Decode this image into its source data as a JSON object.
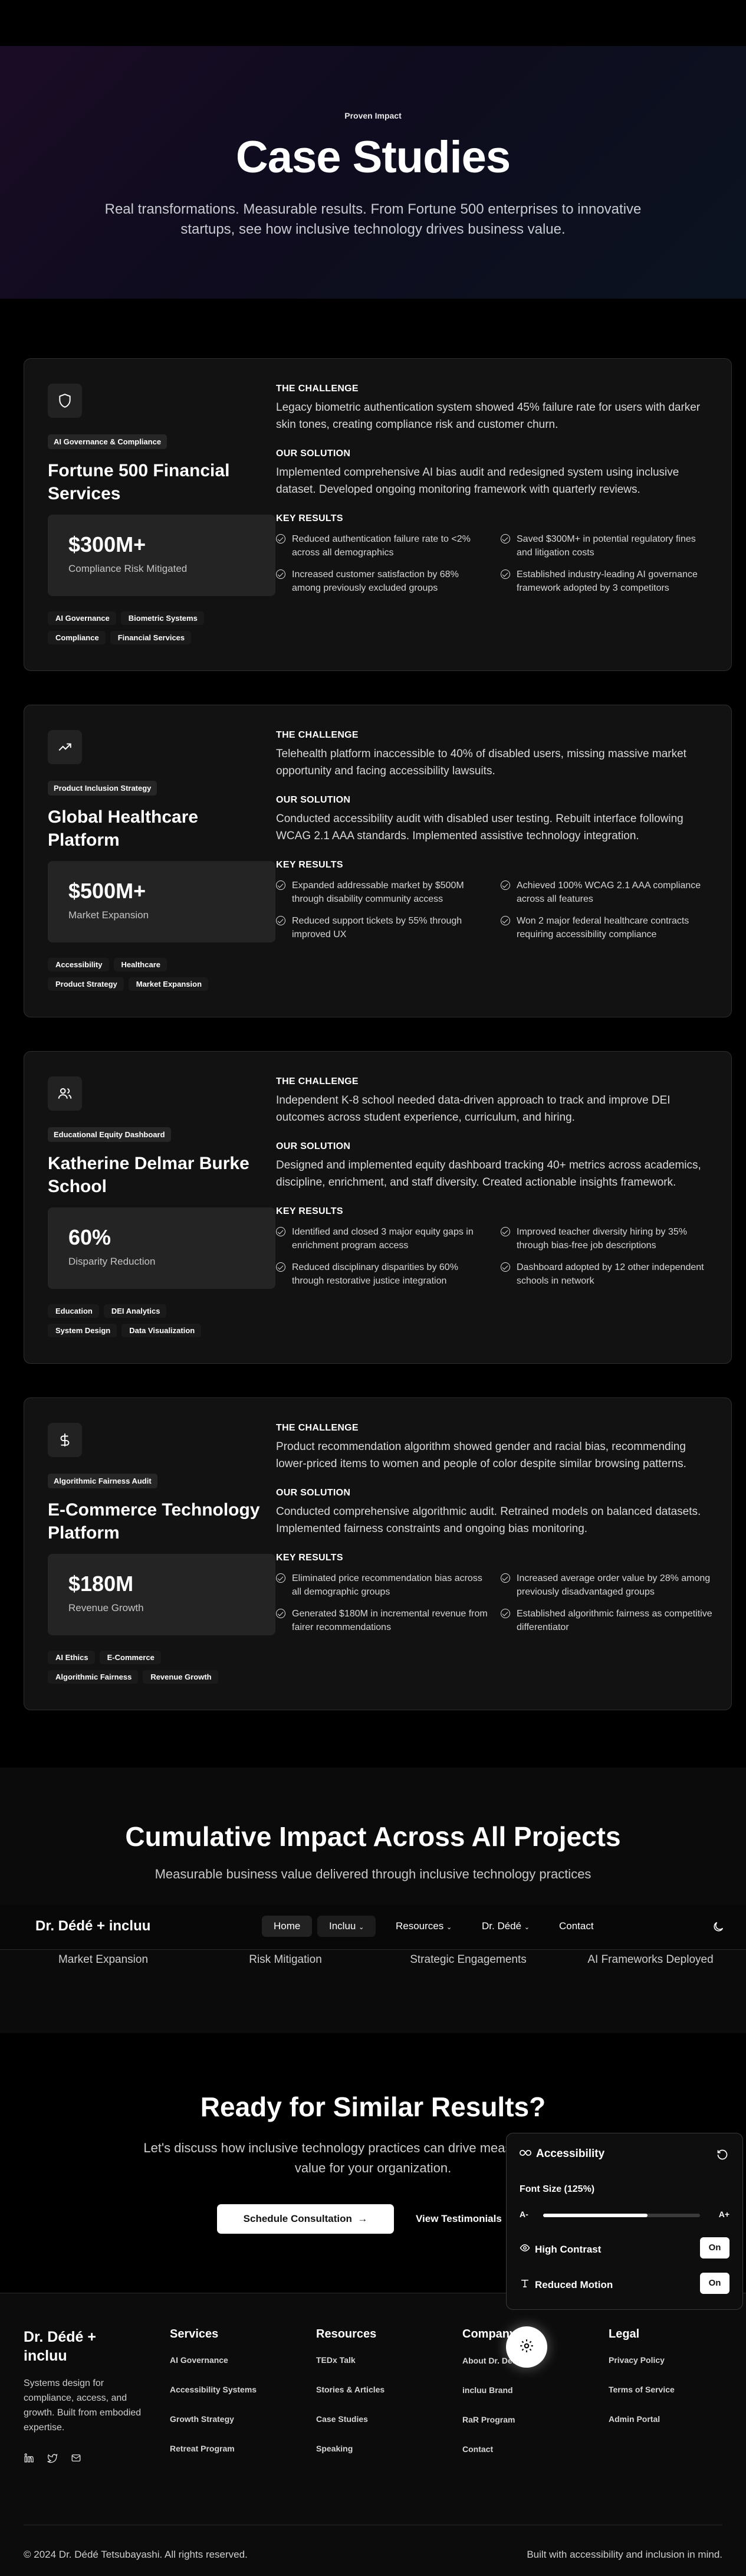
{
  "hero": {
    "kicker": "Proven Impact",
    "title": "Case Studies",
    "subtitle": "Real transformations. Measurable results. From Fortune 500 enterprises to innovative startups, see how inclusive technology drives business value."
  },
  "labels": {
    "challenge": "THE CHALLENGE",
    "solution": "OUR SOLUTION",
    "results": "KEY RESULTS"
  },
  "cases": [
    {
      "icon": "shield-icon",
      "category": "AI Governance & Compliance",
      "title": "Fortune 500 Financial Services",
      "metric_value": "$300M+",
      "metric_label": "Compliance Risk Mitigated",
      "tags": [
        "AI Governance",
        "Biometric Systems",
        "Compliance",
        "Financial Services"
      ],
      "challenge": "Legacy biometric authentication system showed 45% failure rate for users with darker skin tones, creating compliance risk and customer churn.",
      "solution": "Implemented comprehensive AI bias audit and redesigned system using inclusive dataset. Developed ongoing monitoring framework with quarterly reviews.",
      "results": [
        "Reduced authentication failure rate to <2% across all demographics",
        "Saved $300M+ in potential regulatory fines and litigation costs",
        "Increased customer satisfaction by 68% among previously excluded groups",
        "Established industry-leading AI governance framework adopted by 3 competitors"
      ]
    },
    {
      "icon": "trending-up-icon",
      "category": "Product Inclusion Strategy",
      "title": "Global Healthcare Platform",
      "metric_value": "$500M+",
      "metric_label": "Market Expansion",
      "tags": [
        "Accessibility",
        "Healthcare",
        "Product Strategy",
        "Market Expansion"
      ],
      "challenge": "Telehealth platform inaccessible to 40% of disabled users, missing massive market opportunity and facing accessibility lawsuits.",
      "solution": "Conducted accessibility audit with disabled user testing. Rebuilt interface following WCAG 2.1 AAA standards. Implemented assistive technology integration.",
      "results": [
        "Expanded addressable market by $500M through disability community access",
        "Achieved 100% WCAG 2.1 AAA compliance across all features",
        "Reduced support tickets by 55% through improved UX",
        "Won 2 major federal healthcare contracts requiring accessibility compliance"
      ]
    },
    {
      "icon": "users-icon",
      "category": "Educational Equity Dashboard",
      "title": "Katherine Delmar Burke School",
      "metric_value": "60%",
      "metric_label": "Disparity Reduction",
      "tags": [
        "Education",
        "DEI Analytics",
        "System Design",
        "Data Visualization"
      ],
      "challenge": "Independent K-8 school needed data-driven approach to track and improve DEI outcomes across student experience, curriculum, and hiring.",
      "solution": "Designed and implemented equity dashboard tracking 40+ metrics across academics, discipline, enrichment, and staff diversity. Created actionable insights framework.",
      "results": [
        "Identified and closed 3 major equity gaps in enrichment program access",
        "Improved teacher diversity hiring by 35% through bias-free job descriptions",
        "Reduced disciplinary disparities by 60% through restorative justice integration",
        "Dashboard adopted by 12 other independent schools in network"
      ]
    },
    {
      "icon": "dollar-icon",
      "category": "Algorithmic Fairness Audit",
      "title": "E-Commerce Technology Platform",
      "metric_value": "$180M",
      "metric_label": "Revenue Growth",
      "tags": [
        "AI Ethics",
        "E-Commerce",
        "Algorithmic Fairness",
        "Revenue Growth"
      ],
      "challenge": "Product recommendation algorithm showed gender and racial bias, recommending lower-priced items to women and people of color despite similar browsing patterns.",
      "solution": "Conducted comprehensive algorithmic audit. Retrained models on balanced datasets. Implemented fairness constraints and ongoing bias monitoring.",
      "results": [
        "Eliminated price recommendation bias across all demographic groups",
        "Increased average order value by 28% among previously disadvantaged groups",
        "Generated $180M in incremental revenue from fairer recommendations",
        "Established algorithmic fairness as competitive differentiator"
      ]
    }
  ],
  "impact": {
    "title": "Cumulative Impact Across All Projects",
    "subtitle": "Measurable business value delivered through inclusive technology practices",
    "stats": [
      "Market Expansion",
      "Risk Mitigation",
      "Strategic Engagements",
      "AI Frameworks Deployed"
    ]
  },
  "nav": {
    "logo": "Dr. Dédé + incluu",
    "items": [
      "Home",
      "Incluu",
      "Resources",
      "Dr. Dédé",
      "Contact"
    ]
  },
  "cta": {
    "title": "Ready for Similar Results?",
    "subtitle": "Let's discuss how inclusive technology practices can drive measurable business value for your organization.",
    "primary": "Schedule Consultation",
    "secondary": "View Testimonials"
  },
  "a11y": {
    "title": "Accessibility",
    "font_size_label": "Font Size (125%)",
    "font_size_value": 125,
    "decrease": "A-",
    "increase": "A+",
    "high_contrast": "High Contrast",
    "high_contrast_state": "On",
    "reduced_motion": "Reduced Motion",
    "reduced_motion_state": "On"
  },
  "footer": {
    "brand": "Dr. Dédé + incluu",
    "description": "Systems design for compliance, access, and growth. Built from embodied expertise.",
    "columns": [
      {
        "heading": "Services",
        "links": [
          "AI Governance",
          "Accessibility Systems",
          "Growth Strategy",
          "Retreat Program"
        ]
      },
      {
        "heading": "Resources",
        "links": [
          "TEDx Talk",
          "Stories & Articles",
          "Case Studies",
          "Speaking"
        ]
      },
      {
        "heading": "Company",
        "links": [
          "About Dr. Dédé",
          "incluu Brand",
          "RaR Program",
          "Contact"
        ]
      },
      {
        "heading": "Legal",
        "links": [
          "Privacy Policy",
          "Terms of Service",
          "Admin Portal"
        ]
      }
    ],
    "copyright": "© 2024 Dr. Dédé Tetsubayashi. All rights reserved.",
    "built": "Built with accessibility and inclusion in mind."
  }
}
